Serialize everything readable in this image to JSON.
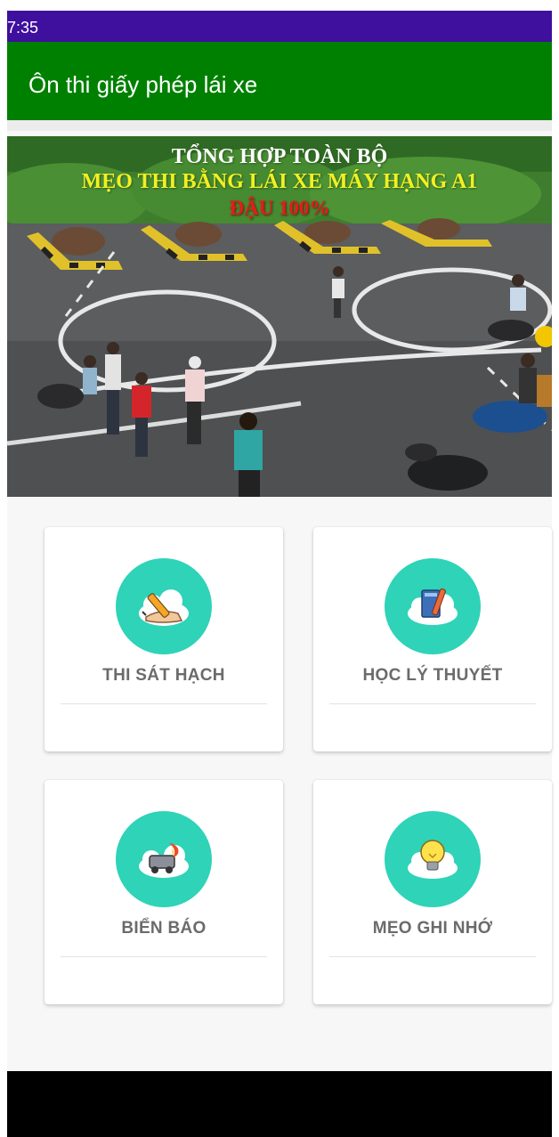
{
  "status_bar": {
    "time": "7:35"
  },
  "app_bar": {
    "title": "Ôn thi giấy phép lái xe"
  },
  "banner": {
    "line1": "TỔNG HỢP TOÀN BỘ",
    "line2": "MẸO THI BẰNG LÁI XE MÁY HẠNG A1",
    "line3": "ĐẬU 100%"
  },
  "menu": {
    "items": [
      {
        "label": "THI SÁT HẠCH",
        "icon": "pencil-hand-icon"
      },
      {
        "label": "HỌC LÝ THUYẾT",
        "icon": "book-pencil-icon"
      },
      {
        "label": "BIỂN BÁO",
        "icon": "car-crash-icon"
      },
      {
        "label": "MẸO GHI NHỚ",
        "icon": "lightbulb-icon"
      }
    ]
  },
  "colors": {
    "status_bar": "#3f0f9e",
    "app_bar": "#008000",
    "icon_circle": "#2ed3b8",
    "label_text": "#6b6b6b"
  }
}
